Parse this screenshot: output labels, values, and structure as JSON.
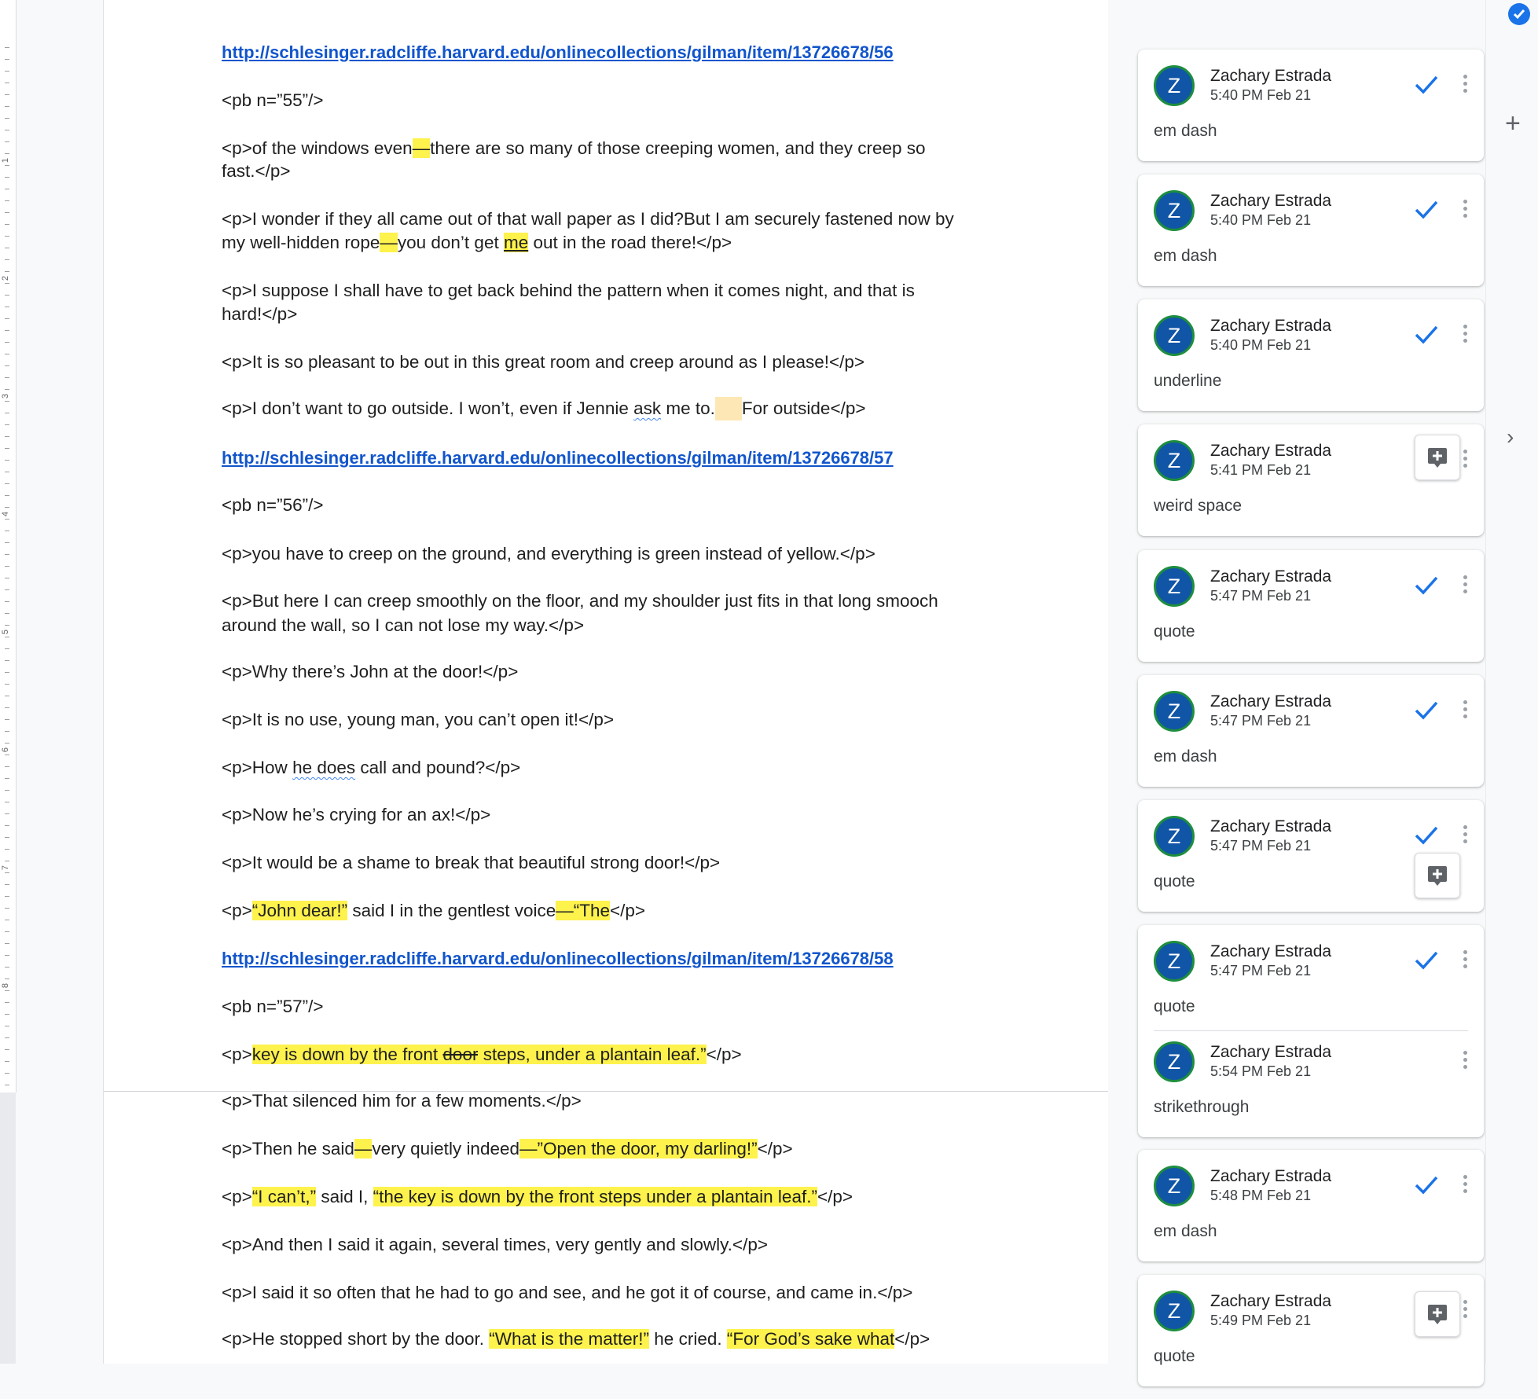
{
  "ruler": {
    "numbers": [
      "1",
      "2",
      "3",
      "4",
      "5",
      "6",
      "7",
      "8"
    ]
  },
  "document": {
    "link1": "http://schlesinger.radcliffe.harvard.edu/onlinecollections/gilman/item/13726678/56",
    "pb55": "<pb n=”55”/>",
    "p1a_1": "<p>of the windows even",
    "p1a_dash": "—",
    "p1a_2": "there are so many of those creeping women, and they creep so",
    "p1b": "fast.</p>",
    "p2a": "<p>I wonder if they all came out of that wall paper as I did?But I am securely fastened now by",
    "p2b_1": "my well-hidden rope",
    "p2b_dash": "—",
    "p2b_2": "you don’t get ",
    "p2b_me": "me",
    "p2b_3": " out in the road there!</p>",
    "p3a": "<p>I suppose I shall have to get back behind the pattern when it comes night, and that is",
    "p3b": "hard!</p>",
    "p4": "<p>It is so pleasant to be out in this great room and creep around as I please!</p>",
    "p5_1": "<p>I don’t want to go outside. I won’t, even if Jennie ",
    "p5_ask": "ask",
    "p5_2": " me to.",
    "p5_3": "For outside</p>",
    "link2": "http://schlesinger.radcliffe.harvard.edu/onlinecollections/gilman/item/13726678/57",
    "pb56": "<pb n=”56”/>",
    "p6": "<p>you have to creep on the ground, and everything is green instead of yellow.</p>",
    "p7a": "<p>But here I can creep smoothly on the floor, and my shoulder just fits in that long smooch",
    "p7b": "around the wall, so I can not lose my way.</p>",
    "p8": "<p>Why there’s John at the door!</p>",
    "p9": "<p>It is no use, young man, you can’t open it!</p>",
    "p10_1": "<p>How ",
    "p10_does": "he does",
    "p10_2": " call and pound?</p>",
    "p11": "<p>Now he’s crying for an ax!</p>",
    "p12": "<p>It would be a shame to break that beautiful strong door!</p>",
    "p13_1": "<p>",
    "p13_q": "“John dear!”",
    "p13_2": " said I in the gentlest voice",
    "p13_dash": "—“The",
    "p13_3": "</p>",
    "link3": "http://schlesinger.radcliffe.harvard.edu/onlinecollections/gilman/item/13726678/58",
    "pb57": "<pb n=”57”/>",
    "p14_1": "<p>",
    "p14_h1": "key is down by the front ",
    "p14_door": "door",
    "p14_h2": " steps, under a plantain leaf.”",
    "p14_2": "</p>",
    "p15": "<p>That silenced him for a few moments.</p>",
    "p16_1": "<p>Then he said",
    "p16_d1": "—",
    "p16_2": "very quietly indeed",
    "p16_d2": "—”Open the door, my darling!”",
    "p16_3": "</p>",
    "p17_1": "<p>",
    "p17_h1": "“I can’t,”",
    "p17_2": " said I, ",
    "p17_h2": "“the key is down by the front steps under a plantain leaf.”",
    "p17_3": "</p>",
    "p18": "<p>And then I said it again, several times, very gently and slowly.</p>",
    "p19": "<p>I said it so often that he had to go and see, and he got it of course, and came in.</p>",
    "p20_1": "<p>He stopped short by the door. ",
    "p20_h1": "“What is the matter!”",
    "p20_2": " he cried. ",
    "p20_h2": "“For God’s sake what",
    "p20_3": "</p>"
  },
  "comments": [
    {
      "initial": "Z",
      "author": "Zachary Estrada",
      "time": "5:40 PM Feb 21",
      "text": "em dash"
    },
    {
      "initial": "Z",
      "author": "Zachary Estrada",
      "time": "5:40 PM Feb 21",
      "text": "em dash"
    },
    {
      "initial": "Z",
      "author": "Zachary Estrada",
      "time": "5:40 PM Feb 21",
      "text": "underline"
    },
    {
      "initial": "Z",
      "author": "Zachary Estrada",
      "time": "5:41 PM Feb 21",
      "text": "weird space"
    },
    {
      "initial": "Z",
      "author": "Zachary Estrada",
      "time": "5:47 PM Feb 21",
      "text": "quote"
    },
    {
      "initial": "Z",
      "author": "Zachary Estrada",
      "time": "5:47 PM Feb 21",
      "text": "em dash"
    },
    {
      "initial": "Z",
      "author": "Zachary Estrada",
      "time": "5:47 PM Feb 21",
      "text": "quote"
    },
    {
      "initial": "Z",
      "author": "Zachary Estrada",
      "time": "5:47 PM Feb 21",
      "text": "quote",
      "reply": {
        "initial": "Z",
        "author": "Zachary Estrada",
        "time": "5:54 PM Feb 21",
        "text": "strikethrough"
      }
    },
    {
      "initial": "Z",
      "author": "Zachary Estrada",
      "time": "5:48 PM Feb 21",
      "text": "em dash"
    },
    {
      "initial": "Z",
      "author": "Zachary Estrada",
      "time": "5:49 PM Feb 21",
      "text": "quote"
    }
  ],
  "icons": {
    "resolve": "check-icon",
    "more": "more-vert-icon",
    "add_comment": "add-comment-icon",
    "add": "plus-icon",
    "expand": "chevron-right-icon",
    "checklist": "checklist-icon"
  },
  "right_panel": {
    "plus": "+",
    "chevron": "›"
  },
  "colors": {
    "highlight": "#fef24c",
    "link": "#1155cc",
    "avatar_bg": "#1155a6",
    "avatar_ring": "#1e8e3e",
    "check": "#1a73e8"
  }
}
